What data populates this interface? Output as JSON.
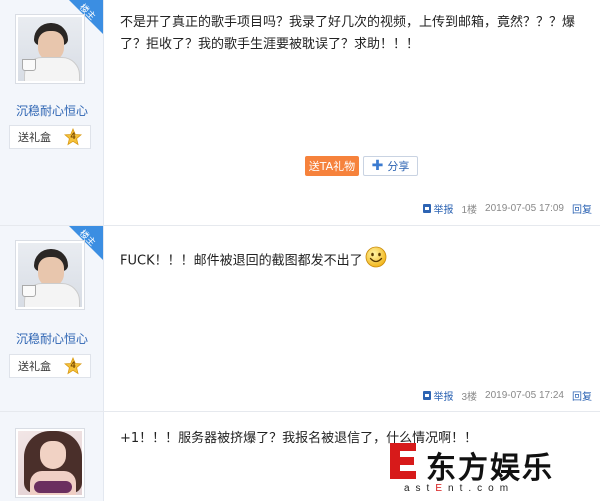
{
  "posts": [
    {
      "badge": "楼主",
      "username": "沉稳耐心恒心",
      "gift_label": "送礼盒",
      "gift_count": "4",
      "content": "不是开了真正的歌手项目吗？我录了好几次的视频，上传到邮箱，竟然？？？爆了？拒收了？我的歌手生涯要被耽误了？求助！！！",
      "gift_button": "送TA礼物",
      "share_button": "分享",
      "report": "举报",
      "floor": "1楼",
      "time": "2019-07-05 17:09",
      "reply": "回复"
    },
    {
      "badge": "楼主",
      "username": "沉稳耐心恒心",
      "gift_label": "送礼盒",
      "gift_count": "4",
      "content": "FUCK！！！邮件被退回的截图都发不出了",
      "emoji": "smiley-emoji",
      "report": "举报",
      "floor": "3楼",
      "time": "2019-07-05 17:24",
      "reply": "回复"
    },
    {
      "content": "+1！！！服务器被挤爆了？我报名被退信了，什么情况啊！！"
    }
  ],
  "watermark": {
    "brand": "东方娱乐",
    "domain_prefix": "ast",
    "domain_e": "E",
    "domain_rest": "nt.com"
  },
  "colors": {
    "accent_blue": "#2d64b3",
    "gift_orange": "#f6823c",
    "badge_blue": "#3b8ee2",
    "watermark_red": "#d71a1a"
  }
}
